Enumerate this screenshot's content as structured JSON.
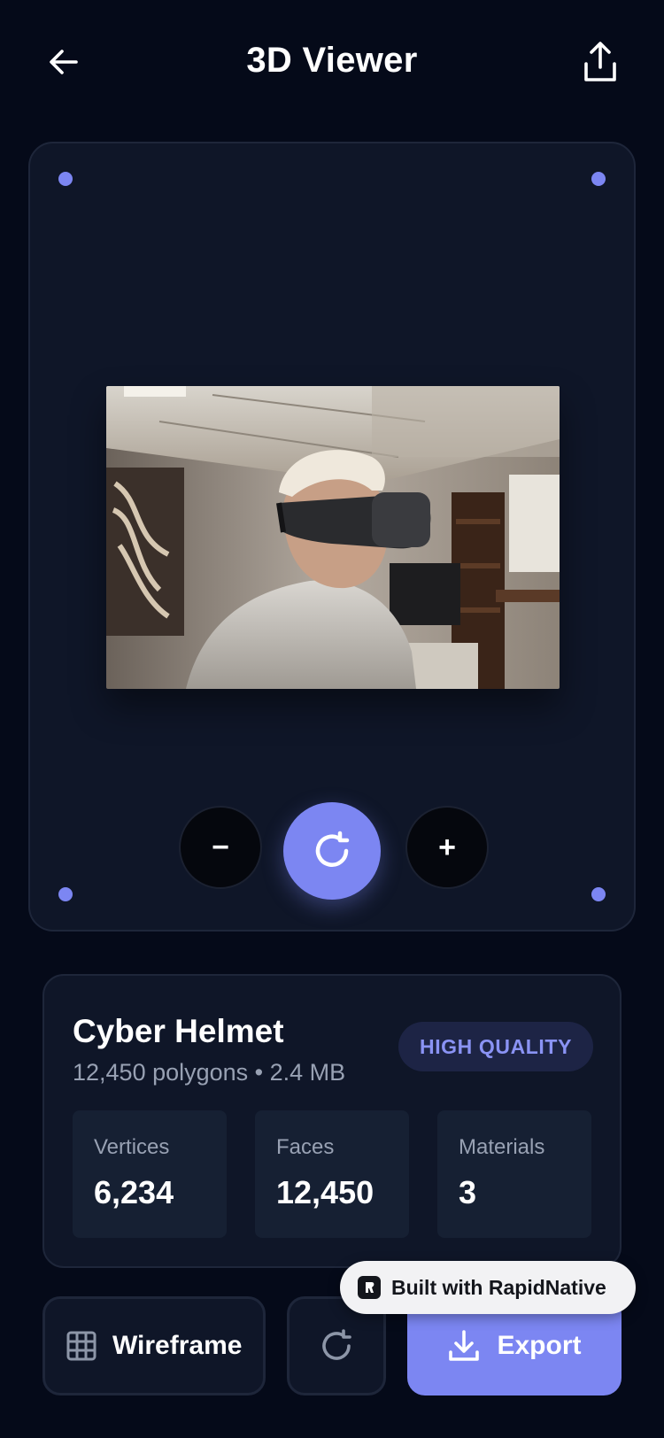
{
  "header": {
    "title": "3D Viewer",
    "back_icon": "arrow-left-icon",
    "share_icon": "share-upload-icon"
  },
  "viewer": {
    "preview_alt": "Man wearing VR headset in office",
    "zoom_out_label": "−",
    "zoom_in_label": "+",
    "rotate_icon": "rotate-icon",
    "accent_color": "#7c86f2"
  },
  "model": {
    "name": "Cyber Helmet",
    "meta": "12,450 polygons • 2.4 MB",
    "quality_badge": "HIGH QUALITY",
    "stats": [
      {
        "label": "Vertices",
        "value": "6,234"
      },
      {
        "label": "Faces",
        "value": "12,450"
      },
      {
        "label": "Materials",
        "value": "3"
      }
    ]
  },
  "actions": {
    "wireframe_label": "Wireframe",
    "wireframe_icon": "grid-icon",
    "reset_icon": "refresh-icon",
    "export_label": "Export",
    "export_icon": "download-icon"
  },
  "branding": {
    "built_with": "Built with RapidNative"
  }
}
